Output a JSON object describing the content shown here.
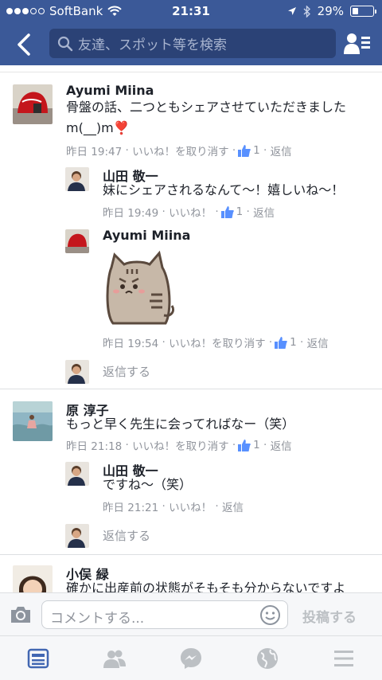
{
  "status": {
    "carrier": "SoftBank",
    "time": "21:31",
    "battery": "29%",
    "battery_level": 0.29,
    "signal_bars": 3
  },
  "header": {
    "search_placeholder": "友達、スポット等を検索"
  },
  "threads": [
    {
      "name": "Ayumi Miina",
      "text_line1": "骨盤の話、二つともシェアさせていただきました",
      "text_line2": "m(__)m❣️",
      "time": "昨日 19:47",
      "like_action": "いいね！を取り消す",
      "like_count": "1",
      "reply_label": "返信",
      "replies": [
        {
          "name": "山田 敬一",
          "text": "妹にシェアされるなんて〜！嬉しいね〜！",
          "time": "昨日 19:49",
          "like_action": "いいね！",
          "like_count": "1",
          "reply_label": "返信"
        },
        {
          "name": "Ayumi Miina",
          "time": "昨日 19:54",
          "like_action": "いいね！を取り消す",
          "like_count": "1",
          "reply_label": "返信"
        }
      ],
      "reply_prompt": "返信する"
    },
    {
      "name": "原 淳子",
      "text": "もっと早く先生に会ってればなー（笑）",
      "time": "昨日 21:18",
      "like_action": "いいね！を取り消す",
      "like_count": "1",
      "reply_label": "返信",
      "replies": [
        {
          "name": "山田 敬一",
          "text": "ですね〜（笑）",
          "time": "昨日 21:21",
          "like_action": "いいね！",
          "reply_label": "返信"
        }
      ],
      "reply_prompt": "返信する"
    },
    {
      "name": "小俣 緑",
      "text": "確かに出産前の状態がそもそも分からないですよ"
    }
  ],
  "composer": {
    "placeholder": "コメントする...",
    "post_label": "投稿する"
  },
  "colors": {
    "brand": "#3b5998",
    "like_blue": "#5890ff",
    "meta_gray": "#90949c"
  }
}
